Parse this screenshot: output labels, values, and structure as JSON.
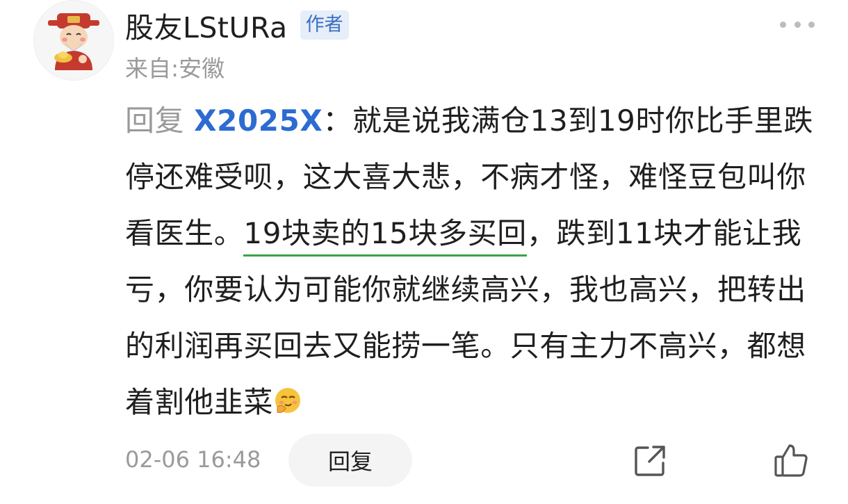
{
  "comment": {
    "username": "股友LStURa",
    "badge": "作者",
    "location": "来自:安徽",
    "reply_prefix": "回复 ",
    "reply_target": "X2025X",
    "text_before": "：就是说我满仓13到19时你比手里跌停还难受呗，这大喜大悲，不病才怪，难怪豆包叫你看医生。",
    "text_underlined": "19块卖的15块多买回",
    "text_after": "，跌到11块才能让我亏，你要认为可能你就继续高兴，我也高兴，把转出的利润再买回去又能捞一笔。只有主力不高兴，都想着割他韭菜",
    "emoji": "smirk-emoji",
    "timestamp": "02-06 16:48",
    "reply_label": "回复"
  },
  "icons": {
    "more": "more-dots-icon",
    "share": "share-icon",
    "like": "thumbs-up-icon"
  },
  "colors": {
    "link": "#2c6bd1",
    "badge_bg": "#e6eef9",
    "badge_text": "#3a6fc0",
    "underline": "#3aa24a",
    "muted": "#9a9a9a"
  }
}
